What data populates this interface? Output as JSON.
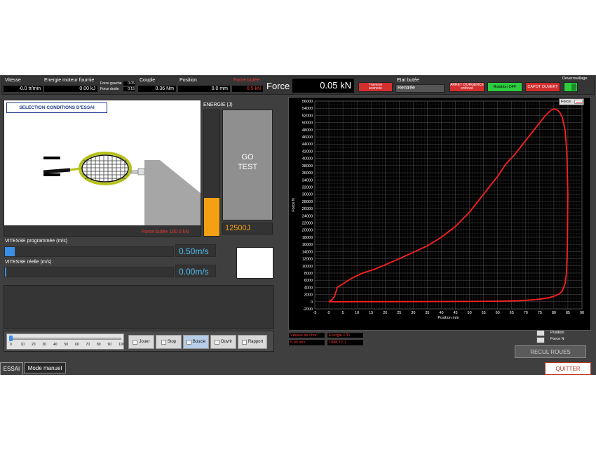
{
  "top_bar": {
    "vitesse": {
      "label": "Vitesse",
      "value": "-0.0 tr/min"
    },
    "energie_moteur": {
      "label": "Energie moteur fournie",
      "value": "0.00 kJ"
    },
    "force_gauche": {
      "label": "Force gauche",
      "value": "0.05"
    },
    "force_droite": {
      "label": "Force droite",
      "value": "0.15"
    },
    "couple": {
      "label": "Couple",
      "value": "0.36 Nm"
    },
    "position": {
      "label": "Position",
      "value": "0.0 mm"
    },
    "force_butee": {
      "label": "Force butée",
      "value": "0.5 kN"
    },
    "force": {
      "label": "Force",
      "value": "0.05 kN"
    },
    "traverse_button": {
      "line1": "Traverse",
      "line2": "avancée"
    },
    "etat_butee": {
      "label": "Etat butée",
      "value": "Rentrée"
    },
    "arret_urgence": {
      "line1": "ARRET D'URGENCE",
      "line2": "enfoncé"
    },
    "rotation": "Rotation OFF",
    "capot": "CAPOT OUVERT",
    "deverrouillage": "Déverrouillage"
  },
  "left": {
    "selection_button": "SELECTION CONDITIONS D'ESSAI",
    "scene_caption": "Force butée 100.0 kN",
    "energie_label": "ENERGIE (J)",
    "go_test": {
      "line1": "GO",
      "line2": "TEST"
    },
    "energie_value": "12500J",
    "energie_fill_pct": 30,
    "vitesse_prog": {
      "label": "VITESSE programmée (m/s)",
      "value": "0.50m/s",
      "fill_pct": 6
    },
    "vitesse_reelle": {
      "label": "VITESSE réelle (m/s)",
      "value": "0.00m/s",
      "fill_pct": 1
    }
  },
  "player": {
    "slider_ticks": [
      "0",
      "10",
      "20",
      "30",
      "40",
      "50",
      "60",
      "70",
      "80",
      "90",
      "100"
    ],
    "buttons": [
      "Jouer",
      "Stop",
      "Boucle",
      "Ouvrir",
      "Rapport"
    ]
  },
  "chart_data": {
    "type": "line",
    "title": "",
    "xlabel": "Position mm",
    "ylabel": "Force N",
    "xlim": [
      -5,
      90
    ],
    "ylim": [
      -2000,
      56000
    ],
    "x_ticks": [
      -5,
      0,
      5,
      10,
      15,
      20,
      25,
      30,
      35,
      40,
      45,
      50,
      55,
      60,
      65,
      70,
      75,
      80,
      85,
      90
    ],
    "y_ticks": [
      -2000,
      0,
      2000,
      4000,
      6000,
      8000,
      10000,
      12000,
      14000,
      16000,
      18000,
      20000,
      22000,
      24000,
      26000,
      28000,
      30000,
      32000,
      34000,
      36000,
      38000,
      40000,
      42000,
      44000,
      46000,
      48000,
      50000,
      52000,
      54000,
      56000
    ],
    "grid": true,
    "legend": "top-right",
    "series": [
      {
        "name": "Force",
        "color": "#ff2020",
        "x": [
          0,
          1,
          2,
          3,
          5,
          8,
          12,
          16,
          20,
          25,
          30,
          35,
          40,
          45,
          50,
          55,
          60,
          63,
          66,
          70,
          74,
          77,
          79,
          80,
          81,
          82,
          83,
          84,
          84.6,
          85,
          84.8,
          84.5,
          84,
          83,
          82,
          80,
          78,
          75,
          72,
          68,
          60,
          50,
          40,
          30,
          20,
          10,
          5,
          2,
          0
        ],
        "y": [
          0,
          500,
          1500,
          4000,
          5000,
          6500,
          8000,
          9000,
          10300,
          12000,
          13800,
          15600,
          18000,
          21000,
          25000,
          30000,
          35000,
          38500,
          41000,
          45000,
          49000,
          52000,
          53500,
          53800,
          53600,
          53000,
          51500,
          48000,
          42000,
          30000,
          15000,
          8000,
          5000,
          3000,
          2200,
          1500,
          1100,
          700,
          500,
          300,
          150,
          80,
          50,
          30,
          20,
          10,
          0,
          0,
          0
        ]
      }
    ]
  },
  "chart_legend": {
    "force_label": "Force",
    "position_label": "Position",
    "force_n_label": "Force N"
  },
  "chart_fields": {
    "vitesse_choc": {
      "label": "Vitesse de choc",
      "value": "5.00 m/s"
    },
    "energie_fd": {
      "label": "Energie F*D",
      "value": "1988.12 J"
    }
  },
  "recul_roues": "RECUL ROUES",
  "tabs": [
    "ESSAI",
    "Mode manuel"
  ],
  "quitter": "QUITTER"
}
